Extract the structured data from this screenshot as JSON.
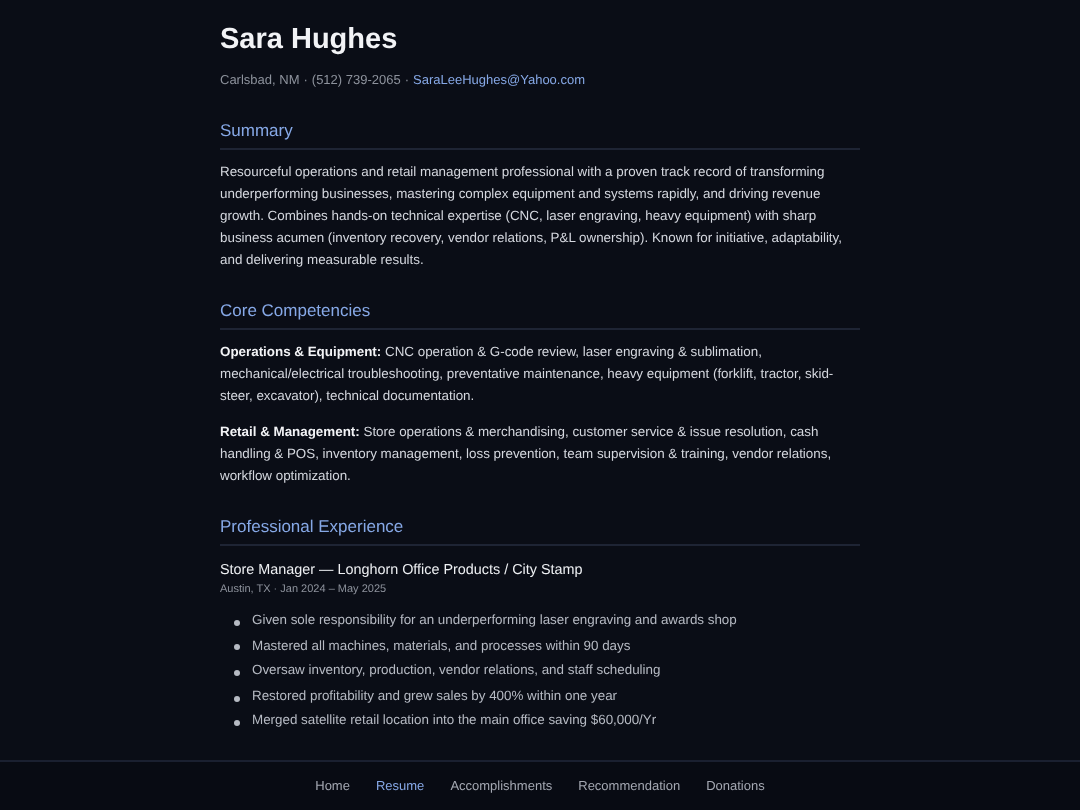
{
  "name": "Sara Hughes",
  "contact": {
    "separator": "·",
    "location": "Carlsbad, NM",
    "phone": "(512) 739-2065",
    "email": "SaraLeeHughes@Yahoo.com"
  },
  "sections": [
    {
      "kind": "paragraphs",
      "heading": "Summary",
      "paragraphs": [
        "Resourceful operations and retail management professional with a proven track record of transforming underperforming businesses, mastering complex equipment and systems rapidly, and driving revenue growth. Combines hands-on technical expertise (CNC, laser engraving, heavy equipment) with sharp business acumen (inventory recovery, vendor relations, P&L ownership). Known for initiative, adaptability, and delivering measurable results."
      ]
    },
    {
      "kind": "paragraphs",
      "heading": "Core Competencies",
      "paragraphs": [
        "**Operations & Equipment:** CNC operation & G-code review, laser engraving & sublimation, mechanical/electrical troubleshooting, preventative maintenance, heavy equipment (forklift, tractor, skid-steer, excavator), technical documentation.",
        "**Retail & Management:** Store operations & merchandising, customer service & issue resolution, cash handling & POS, inventory management, loss prevention, team supervision & training, vendor relations, workflow optimization."
      ]
    },
    {
      "kind": "jobs",
      "heading": "Professional Experience",
      "jobs": [
        {
          "title": "Store Manager — Longhorn Office Products / City Stamp",
          "meta": "Austin, TX · Jan 2024 – May 2025",
          "bullets": [
            "Given sole responsibility for an underperforming laser engraving and awards shop",
            "Mastered all machines, materials, and processes within 90 days",
            "Oversaw inventory, production, vendor relations, and staff scheduling",
            "Restored profitability and grew sales by 400% within one year",
            "Merged satellite retail location into the main office saving $60,000/Yr"
          ]
        }
      ]
    }
  ],
  "nav": [
    {
      "label": "Home",
      "selected": false
    },
    {
      "label": "Resume",
      "selected": true
    },
    {
      "label": "Accomplishments",
      "selected": false
    },
    {
      "label": "Recommendation",
      "selected": false
    },
    {
      "label": "Donations",
      "selected": false
    }
  ]
}
